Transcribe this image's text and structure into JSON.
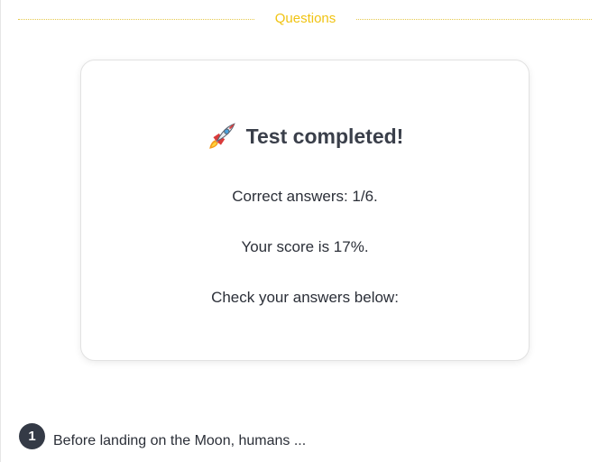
{
  "section": {
    "title": "Questions"
  },
  "result": {
    "icon": "rocket-icon",
    "heading": "Test completed!",
    "correct_answers": "Correct answers: 1/6.",
    "score": "Your score is 17%.",
    "instruction": "Check your answers below:"
  },
  "questions": [
    {
      "number": "1",
      "text": "Before landing on the Moon, humans ..."
    }
  ],
  "colors": {
    "accent": "#f0c312",
    "badge": "#343a46",
    "text": "#2b2f38"
  }
}
